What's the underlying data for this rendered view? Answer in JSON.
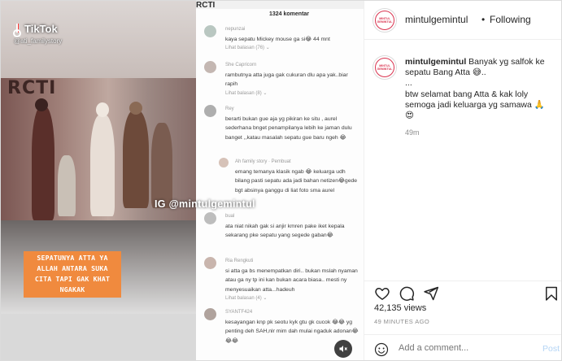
{
  "media": {
    "tiktok_brand": "TikTok",
    "tiktok_user": "@ati_familystory",
    "station_logo": "RCTI",
    "caption_lines": [
      "SEPATUNYA ATTA YA",
      "ALLAH ANTARA SUKA",
      "CITA TAPI GAK KHAT",
      "NGAKAK"
    ],
    "watermark": "IG @mintulgemintul",
    "comments_screen": {
      "header_logo": "RCTI",
      "count": "1324 komentar",
      "comments": [
        {
          "user": "nepunzai",
          "text": "kaya sepatu Mickey mouse ga si😂 44 mnt",
          "reply": "Lihat balasan (76) ⌄"
        },
        {
          "user": "She Capricorn",
          "text": "rambutnya atta juga gak cukuran dlu apa yak..biar rapih",
          "reply": "Lihat balasan (8) ⌄"
        },
        {
          "user": "Rey",
          "text": "berarti bukan gue aja yg pikiran ke situ , aurel sederhana bnget penampilanya lebih ke jaman dulu banget ,,katau masalah sepatu gue baru ngeh 😂",
          "reply": ""
        },
        {
          "user": "Ah family story · Pembuat",
          "text": "emang temanya klasik ngab 😂 keluarga udh bilang pasti sepatu ada jadi bahan netizen😂gede bgt absinya ganggu di liat foto sma aurel",
          "reply": ""
        },
        {
          "user": "bual",
          "text": "ata niat nikah gak si anjir kmren pake iket kepala sekarang pke sepatu yang segede gaban😂",
          "reply": ""
        },
        {
          "user": "Ria Rengkuti",
          "text": "si atta ga bs menempatkan diri.. bukan mslah nyaman atau ga ny tp ini kan bukan acara biasa.. mesti ny menyesuaikan atta...hadeuh",
          "reply": "Lihat balasan (4) ⌄"
        },
        {
          "user": "SYANTF424",
          "text": "kesayangan knp pk seotu kyk gtu gk cucok 😂😂 yg penting deh SAH,nlr mim dah mulai ngaduk adonan😂😂😂",
          "reply": ""
        }
      ]
    }
  },
  "header": {
    "username": "mintulgemintul",
    "separator": "•",
    "follow_status": "Following",
    "avatar_text": "MINTUL GEMINTUL"
  },
  "post": {
    "username": "mintulgemintul",
    "caption_first": "Banyak yg salfok ke sepatu Bang Atta 😅..",
    "caption_dots": "...",
    "caption_rest": "btw selamat bang Atta & kak loly semoga jadi keluarga yg samawa 🙏",
    "caption_emoji": "😍",
    "time": "49m"
  },
  "stats": {
    "views": "42,135 views",
    "posted": "49 MINUTES AGO"
  },
  "comment_box": {
    "placeholder": "Add a comment...",
    "post_label": "Post"
  },
  "icons": [
    "heart-icon",
    "comment-icon",
    "share-icon",
    "bookmark-icon",
    "emoji-icon",
    "sound-off-icon"
  ],
  "colors": {
    "caption_box": "#f08a3e",
    "avatar_ring": "#d9334f",
    "post_button": "#b3d4f5"
  }
}
